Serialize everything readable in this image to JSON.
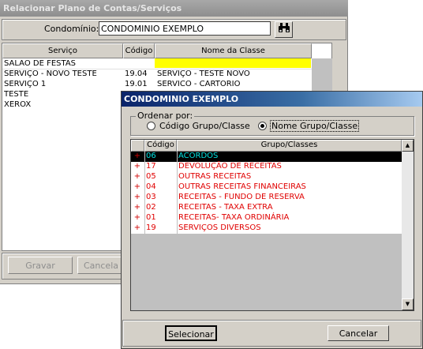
{
  "background_window": {
    "title": "Relacionar Plano de Contas/Serviços",
    "condominio_label": "Condomínio:",
    "condominio_value": "CONDOMINIO EXEMPLO",
    "search_icon": "binoculars-icon",
    "columns": [
      "Serviço",
      "Código",
      "Nome da Classe"
    ],
    "rows": [
      {
        "servico": "SALÃO DE FESTAS",
        "codigo": "",
        "classe": ""
      },
      {
        "servico": "SERVIÇO - NOVO TESTE",
        "codigo": "19.04",
        "classe": "SERVIÇO - TESTE NOVO"
      },
      {
        "servico": "SERVIÇO 1",
        "codigo": "19.01",
        "classe": "SERVICO - CARTÓRIO"
      },
      {
        "servico": "TESTE",
        "codigo": "",
        "classe": ""
      },
      {
        "servico": "XEROX",
        "codigo": "",
        "classe": ""
      }
    ],
    "gravar_label": "Gravar",
    "cancelar_label": "Cancela"
  },
  "dialog": {
    "title": "CONDOMINIO EXEMPLO",
    "sort_legend": "Ordenar por:",
    "sort_options": [
      "Código Grupo/Classe",
      "Nome Grupo/Classe"
    ],
    "sort_selected": "Nome Grupo/Classe",
    "columns": [
      "Código",
      "Grupo/Classes"
    ],
    "rows": [
      {
        "marker": "+",
        "codigo": "06",
        "nome": "ACORDOS",
        "selected": true
      },
      {
        "marker": "+",
        "codigo": "17",
        "nome": "DEVOLUÇÃO DE RECEITAS"
      },
      {
        "marker": "+",
        "codigo": "05",
        "nome": "OUTRAS RECEITAS"
      },
      {
        "marker": "+",
        "codigo": "04",
        "nome": "OUTRAS RECEITAS FINANCEIRAS"
      },
      {
        "marker": "+",
        "codigo": "03",
        "nome": "RECEITAS - FUNDO DE RESERVA"
      },
      {
        "marker": "+",
        "codigo": "02",
        "nome": "RECEITAS - TAXA EXTRA"
      },
      {
        "marker": "+",
        "codigo": "01",
        "nome": "RECEITAS- TAXA ORDINÁRIA"
      },
      {
        "marker": "+",
        "codigo": "19",
        "nome": "SERVIÇOS DIVERSOS"
      }
    ],
    "selecionar_label": "Selecionar",
    "cancelar_label": "Cancelar"
  },
  "colors": {
    "selected_row_bg": "#000000",
    "selected_row_text": "#00e0e0",
    "row_text": "#e00000",
    "highlight_cell": "#ffff00",
    "dialog_title_gradient_start": "#0a246a"
  }
}
